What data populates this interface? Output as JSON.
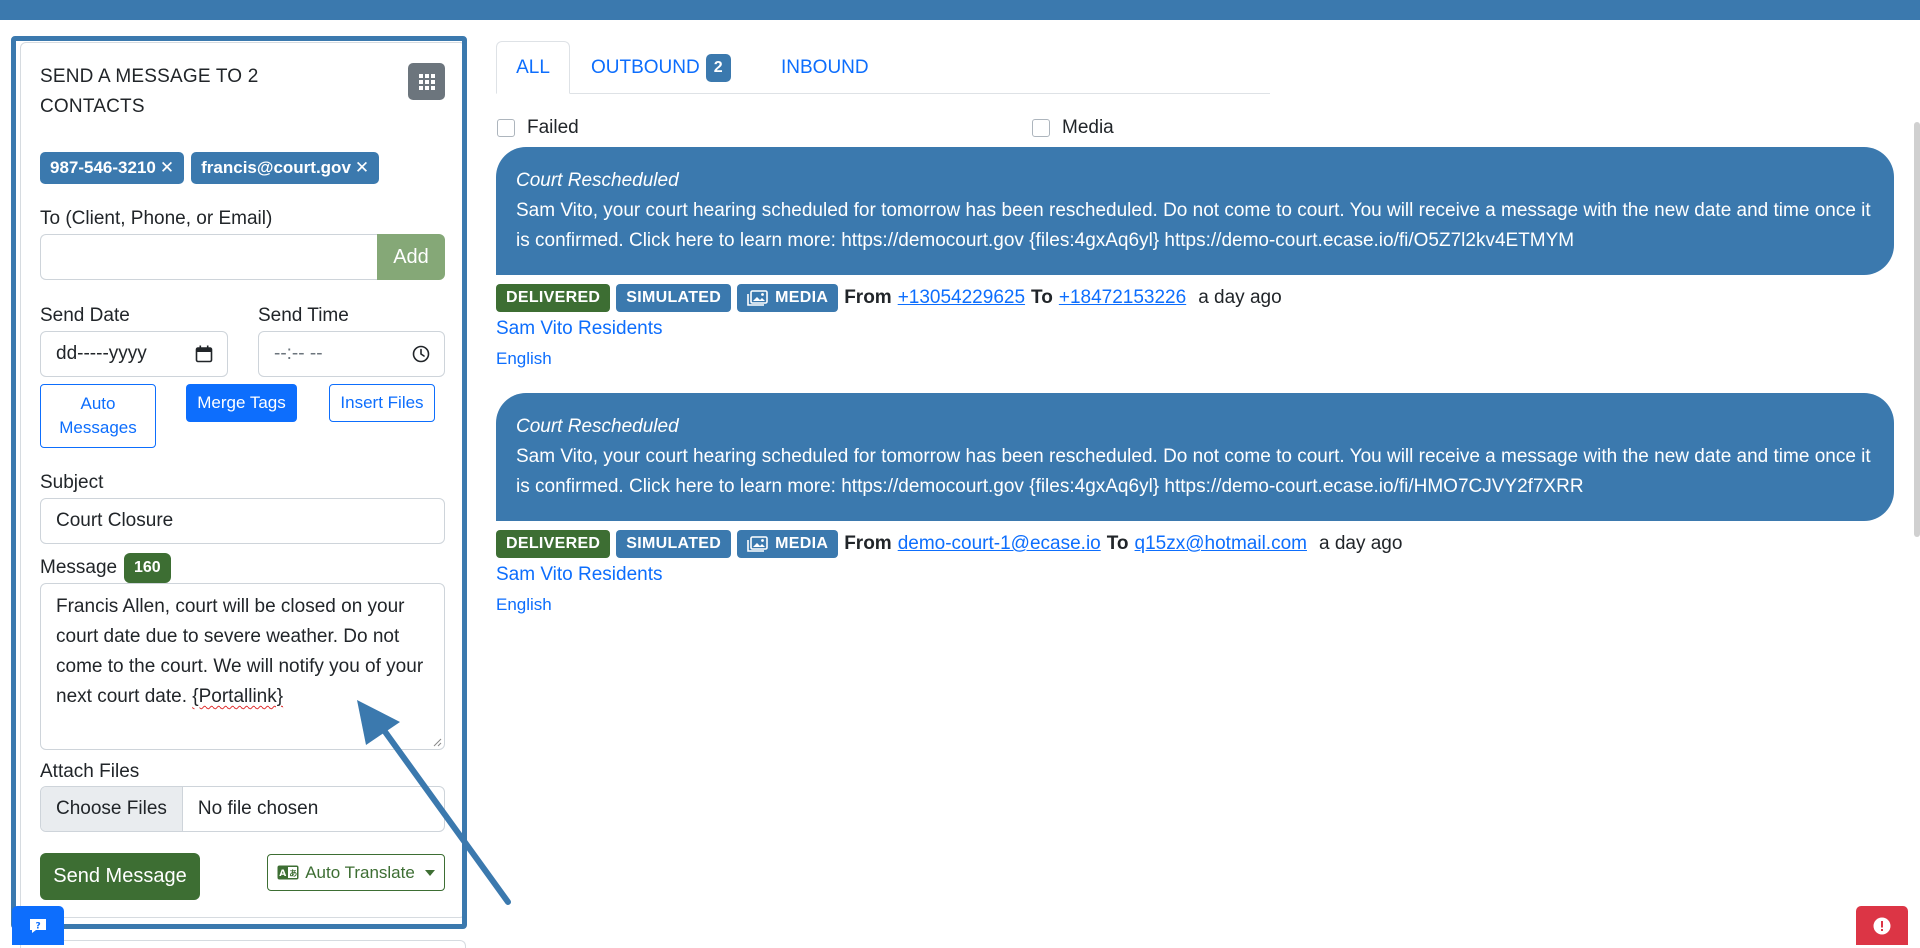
{
  "compose": {
    "title": "SEND A MESSAGE TO 2 CONTACTS",
    "chips": [
      "987-546-3210",
      "francis@court.gov"
    ],
    "chip_remove_glyph": "✕",
    "to_label": "To (Client, Phone, or Email)",
    "to_value": "",
    "add_label": "Add",
    "send_date_label": "Send Date",
    "send_date_placeholder": "dd-----yyyy",
    "send_time_label": "Send Time",
    "send_time_placeholder": "--:-- --",
    "auto_messages_label": "Auto Messages",
    "merge_tags_label": "Merge Tags",
    "insert_files_label": "Insert Files",
    "subject_label": "Subject",
    "subject_value": "Court Closure",
    "message_label": "Message",
    "message_count": "160",
    "message_text": "Francis Allen, court will be closed on your court date due to severe weather. Do not come to the court. We will notify you of your next court date.",
    "message_token": "{Portallink}",
    "attach_label": "Attach Files",
    "choose_files_label": "Choose Files",
    "file_status": "No file chosen",
    "send_label": "Send Message",
    "translate_label": "Auto Translate"
  },
  "tabs": {
    "all": "ALL",
    "outbound": "OUTBOUND",
    "outbound_count": "2",
    "inbound": "INBOUND"
  },
  "filters": {
    "failed": "Failed",
    "media": "Media"
  },
  "messages": [
    {
      "title": "Court Rescheduled",
      "body": "Sam Vito, your court hearing scheduled for tomorrow has been rescheduled. Do not come to court. You will receive a message with the new date and time once it is confirmed. Click here to learn more: https://democourt.gov {files:4gxAq6yl} https://demo-court.ecase.io/fi/O5Z7l2kv4ETMYM",
      "status": "DELIVERED",
      "mode": "SIMULATED",
      "media": "MEDIA",
      "from_label": "From",
      "from": "+13054229625",
      "to_label": "To",
      "to": "+18472153226",
      "time": "a day ago",
      "group": "Sam Vito Residents",
      "language": "English"
    },
    {
      "title": "Court Rescheduled",
      "body": "Sam Vito, your court hearing scheduled for tomorrow has been rescheduled. Do not come to court. You will receive a message with the new date and time once it is confirmed. Click here to learn more: https://democourt.gov {files:4gxAq6yl} https://demo-court.ecase.io/fi/HMO7CJVY2f7XRR",
      "status": "DELIVERED",
      "mode": "SIMULATED",
      "media": "MEDIA",
      "from_label": "From",
      "from": "demo-court-1@ecase.io",
      "to_label": "To",
      "to": "q15zx@hotmail.com",
      "time": "a day ago",
      "group": "Sam Vito Residents",
      "language": "English"
    }
  ],
  "colors": {
    "brand_blue": "#3b79ae",
    "success_green": "#3d6e33",
    "link_blue": "#0d6efd",
    "danger_red": "#dc3545"
  },
  "icons": {
    "grid": "grid-icon",
    "calendar": "calendar-icon",
    "clock": "clock-icon",
    "translate": "translate-icon",
    "media": "image-icon",
    "chat": "chat-icon",
    "alert": "alert-icon"
  }
}
